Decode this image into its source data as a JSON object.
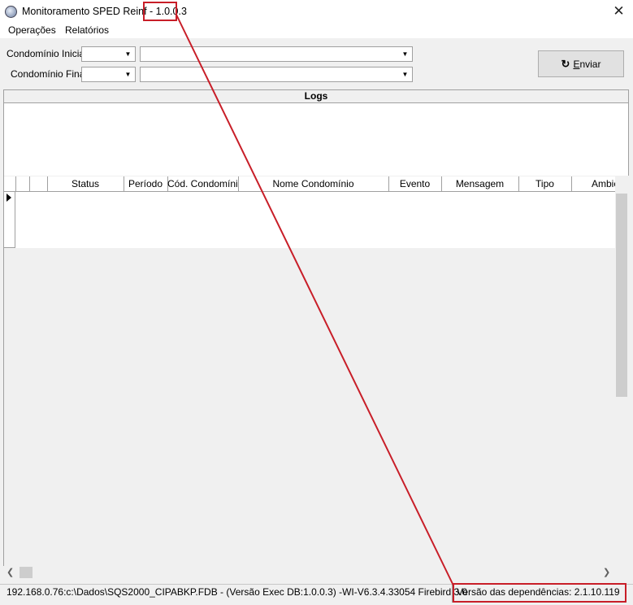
{
  "window": {
    "title": "Monitoramento SPED Reinf -",
    "version": "1.0.0.3",
    "close_glyph": "✕"
  },
  "menu": {
    "items": [
      {
        "label": "Operações"
      },
      {
        "label": "Relatórios"
      }
    ]
  },
  "filters": {
    "condominio_inicial_label": "Condomínio Inicial",
    "condominio_final_label": "Condomínio Final",
    "inicial_code": "",
    "inicial_name": "",
    "final_code": "",
    "final_name": ""
  },
  "actions": {
    "send_label": "Enviar",
    "send_hotkey": "E",
    "send_icon": "refresh-icon"
  },
  "logs": {
    "title": "Logs",
    "content": ""
  },
  "grid": {
    "columns": [
      {
        "label": ""
      },
      {
        "label": "Status"
      },
      {
        "label": "Período"
      },
      {
        "label": "Cód. Condomínio"
      },
      {
        "label": "Nome Condomínio"
      },
      {
        "label": "Evento"
      },
      {
        "label": "Mensagem"
      },
      {
        "label": "Tipo"
      },
      {
        "label": "Ambie"
      }
    ],
    "rows": 4
  },
  "status": {
    "connection": "192.168.0.76:c:\\Dados\\SQS2000_CIPABKP.FDB - (Versão Exec DB:1.0.0.3) -WI-V6.3.4.33054 Firebird 3.0",
    "dependencies": "Versão das dependências: 2.1.10.119"
  },
  "colors": {
    "annotation": "#c81e28",
    "window_bg": "#f0f0f0"
  }
}
